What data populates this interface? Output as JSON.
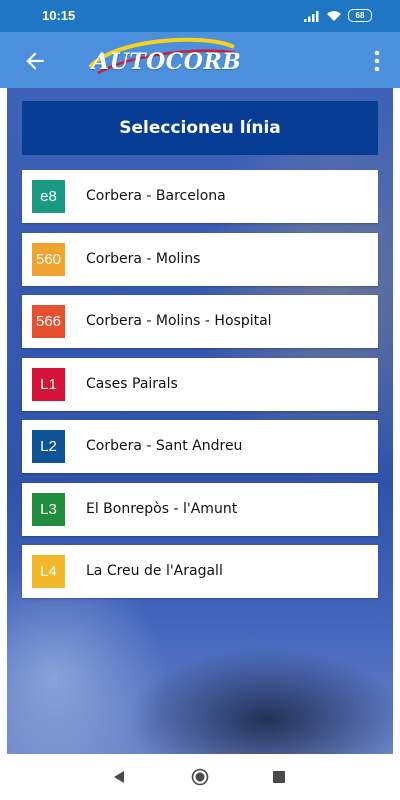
{
  "status_bar": {
    "time": "10:15",
    "battery": "68",
    "icons": [
      "signal-icon",
      "wifi-icon",
      "battery-icon"
    ]
  },
  "app_bar": {
    "logo_text": "AUTOCORB",
    "icons": [
      "back-arrow-icon",
      "more-vert-icon"
    ],
    "color": "#4b8fdd"
  },
  "header": {
    "title": "Seleccioneu línia"
  },
  "lines": [
    {
      "code": "e8",
      "name": "Corbera - Barcelona",
      "color": "#1a9a83"
    },
    {
      "code": "560",
      "name": "Corbera - Molins",
      "color": "#f0a32e"
    },
    {
      "code": "566",
      "name": "Corbera - Molins - Hospital",
      "color": "#e6502f"
    },
    {
      "code": "L1",
      "name": "Cases Pairals",
      "color": "#d5133b"
    },
    {
      "code": "L2",
      "name": "Corbera - Sant Andreu",
      "color": "#0e5396"
    },
    {
      "code": "L3",
      "name": "El Bonrepòs - l'Amunt",
      "color": "#208d3e"
    },
    {
      "code": "L4",
      "name": "La Creu de l'Aragall",
      "color": "#f3b82a"
    }
  ],
  "nav_bar": {
    "icons": [
      "nav-back-icon",
      "nav-home-icon",
      "nav-recents-icon"
    ]
  }
}
